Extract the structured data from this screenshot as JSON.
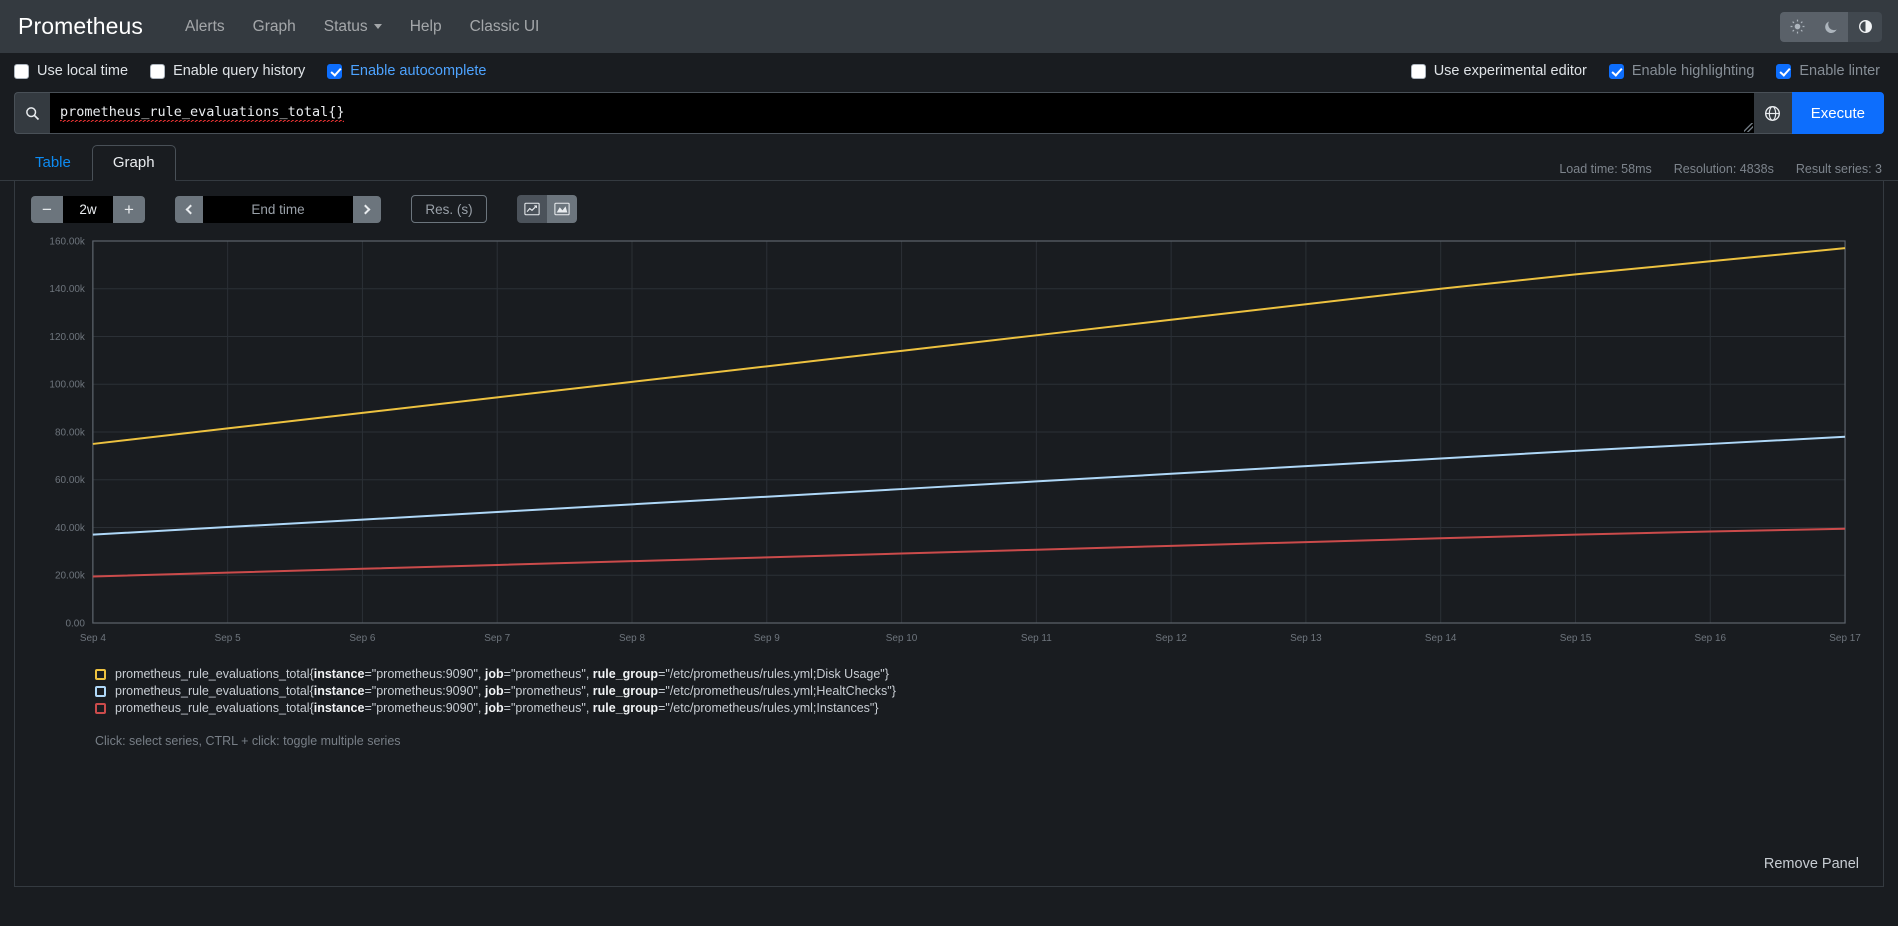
{
  "navbar": {
    "brand": "Prometheus",
    "links": [
      {
        "label": "Alerts",
        "dropdown": false
      },
      {
        "label": "Graph",
        "dropdown": false
      },
      {
        "label": "Status",
        "dropdown": true
      },
      {
        "label": "Help",
        "dropdown": false
      },
      {
        "label": "Classic UI",
        "dropdown": false
      }
    ],
    "themes": [
      {
        "name": "light-theme-button",
        "icon": "sun-icon",
        "active": false
      },
      {
        "name": "dark-theme-button",
        "icon": "moon-icon",
        "active": false
      },
      {
        "name": "auto-theme-button",
        "icon": "half-circle-icon",
        "active": true
      }
    ]
  },
  "options": {
    "left": [
      {
        "label": "Use local time",
        "checked": false,
        "style": "normal"
      },
      {
        "label": "Enable query history",
        "checked": false,
        "style": "normal"
      },
      {
        "label": "Enable autocomplete",
        "checked": true,
        "style": "blue"
      }
    ],
    "right": [
      {
        "label": "Use experimental editor",
        "checked": false,
        "style": "normal"
      },
      {
        "label": "Enable highlighting",
        "checked": true,
        "style": "muted"
      },
      {
        "label": "Enable linter",
        "checked": true,
        "style": "muted"
      }
    ]
  },
  "query": {
    "icon": "search-icon",
    "value": "prometheus_rule_evaluations_total{}",
    "metric_explorer_icon": "globe-icon",
    "execute_label": "Execute"
  },
  "tabs": [
    {
      "label": "Table",
      "active": false
    },
    {
      "label": "Graph",
      "active": true
    }
  ],
  "meta": {
    "load_time": "Load time: 58ms",
    "resolution": "Resolution: 4838s",
    "result_series": "Result series: 3"
  },
  "controls": {
    "decrease_label": "−",
    "range_value": "2w",
    "increase_label": "+",
    "prev_icon": "chevron-left-icon",
    "end_time_value": "",
    "end_time_placeholder": "End time",
    "next_icon": "chevron-right-icon",
    "resolution_value": "",
    "resolution_placeholder": "Res. (s)",
    "chart_type_line_icon": "line-chart-icon",
    "chart_type_stacked_icon": "stacked-chart-icon"
  },
  "footer": {
    "remove_panel_label": "Remove Panel"
  },
  "legend": {
    "hint": "Click: select series, CTRL + click: toggle multiple series",
    "items": [
      {
        "color": "#edc240",
        "metric": "prometheus_rule_evaluations_total{",
        "labels": [
          {
            "key": "instance",
            "value": "=\"prometheus:9090\", "
          },
          {
            "key": "job",
            "value": "=\"prometheus\", "
          },
          {
            "key": "rule_group",
            "value": "=\"/etc/prometheus/rules.yml;Disk Usage\"}"
          }
        ]
      },
      {
        "color": "#afd8f8",
        "metric": "prometheus_rule_evaluations_total{",
        "labels": [
          {
            "key": "instance",
            "value": "=\"prometheus:9090\", "
          },
          {
            "key": "job",
            "value": "=\"prometheus\", "
          },
          {
            "key": "rule_group",
            "value": "=\"/etc/prometheus/rules.yml;HealtChecks\"}"
          }
        ]
      },
      {
        "color": "#cb4b4b",
        "metric": "prometheus_rule_evaluations_total{",
        "labels": [
          {
            "key": "instance",
            "value": "=\"prometheus:9090\", "
          },
          {
            "key": "job",
            "value": "=\"prometheus\", "
          },
          {
            "key": "rule_group",
            "value": "=\"/etc/prometheus/rules.yml;Instances\"}"
          }
        ]
      }
    ]
  },
  "chart_data": {
    "type": "line",
    "title": "",
    "xlabel": "",
    "ylabel": "",
    "grid": true,
    "legend_position": "below",
    "ylim": [
      0,
      160000
    ],
    "yticks": [
      0,
      20000,
      40000,
      60000,
      80000,
      100000,
      120000,
      140000,
      160000
    ],
    "ytick_labels": [
      "0.00",
      "20.00k",
      "40.00k",
      "60.00k",
      "80.00k",
      "100.00k",
      "120.00k",
      "140.00k",
      "160.00k"
    ],
    "x": [
      "Sep 4",
      "Sep 5",
      "Sep 6",
      "Sep 7",
      "Sep 8",
      "Sep 9",
      "Sep 10",
      "Sep 11",
      "Sep 12",
      "Sep 13",
      "Sep 14",
      "Sep 15",
      "Sep 16",
      "Sep 17"
    ],
    "xtick_labels": [
      "Sep 4",
      "Sep 5",
      "Sep 6",
      "Sep 7",
      "Sep 8",
      "Sep 9",
      "Sep 10",
      "Sep 11",
      "Sep 12",
      "Sep 13",
      "Sep 14",
      "Sep 15",
      "Sep 16",
      "Sep 17"
    ],
    "series": [
      {
        "name": "prometheus_rule_evaluations_total{instance=\"prometheus:9090\", job=\"prometheus\", rule_group=\"/etc/prometheus/rules.yml;Disk Usage\"}",
        "color": "#edc240",
        "values": [
          75000,
          81500,
          88000,
          94500,
          101000,
          107500,
          114000,
          120500,
          127000,
          133500,
          140000,
          146000,
          151500,
          157000
        ]
      },
      {
        "name": "prometheus_rule_evaluations_total{instance=\"prometheus:9090\", job=\"prometheus\", rule_group=\"/etc/prometheus/rules.yml;HealtChecks\"}",
        "color": "#afd8f8",
        "values": [
          37000,
          40200,
          43300,
          46500,
          49700,
          52900,
          56100,
          59300,
          62500,
          65700,
          68900,
          72100,
          75000,
          78000
        ]
      },
      {
        "name": "prometheus_rule_evaluations_total{instance=\"prometheus:9090\", job=\"prometheus\", rule_group=\"/etc/prometheus/rules.yml;Instances\"}",
        "color": "#cb4b4b",
        "values": [
          19500,
          21100,
          22700,
          24300,
          25900,
          27500,
          29100,
          30700,
          32300,
          33900,
          35500,
          37000,
          38300,
          39500
        ]
      }
    ]
  }
}
